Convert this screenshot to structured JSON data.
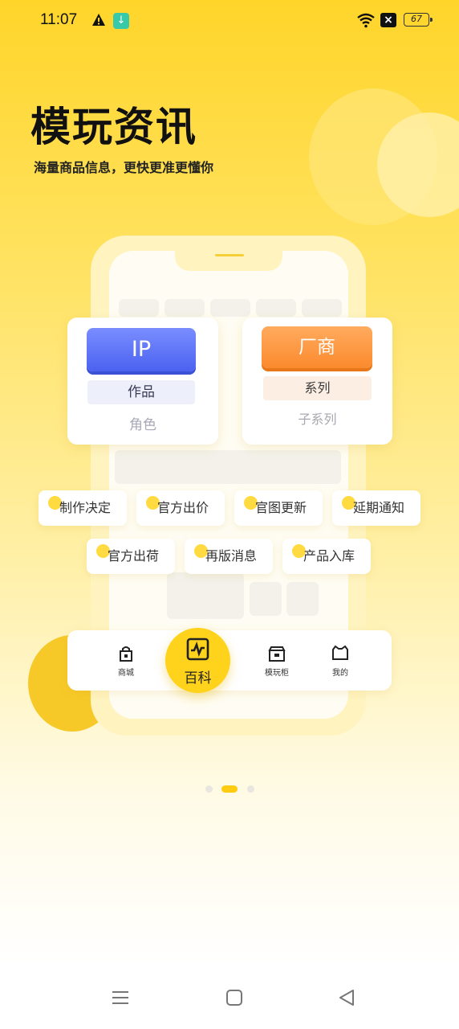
{
  "status_bar": {
    "time": "11:07",
    "battery": "67",
    "icons": [
      "warning-icon",
      "download-icon",
      "wifi-icon",
      "no-sim-icon",
      "battery-icon"
    ]
  },
  "hero": {
    "title": "模玩资讯",
    "subtitle": "海量商品信息，更快更准更懂你"
  },
  "cards": {
    "ip": {
      "button": "IP",
      "tag": "作品",
      "sub": "角色"
    },
    "maker": {
      "button": "厂商",
      "tag": "系列",
      "sub": "子系列"
    }
  },
  "chips": {
    "row1": [
      "制作决定",
      "官方出价",
      "官图更新",
      "延期通知"
    ],
    "row2": [
      "官方出荷",
      "再版消息",
      "产品入库"
    ]
  },
  "nav_mock": {
    "shop": "商城",
    "wiki": "百科",
    "cabinet": "模玩柜",
    "mine": "我的"
  },
  "colors": {
    "accent_yellow": "#ffd21c",
    "ip_blue": "#4a62f0",
    "maker_orange": "#fb8a2e"
  },
  "pagination": {
    "count": 3,
    "active": 2
  },
  "system_nav": [
    "menu-icon",
    "home-icon",
    "back-icon"
  ]
}
